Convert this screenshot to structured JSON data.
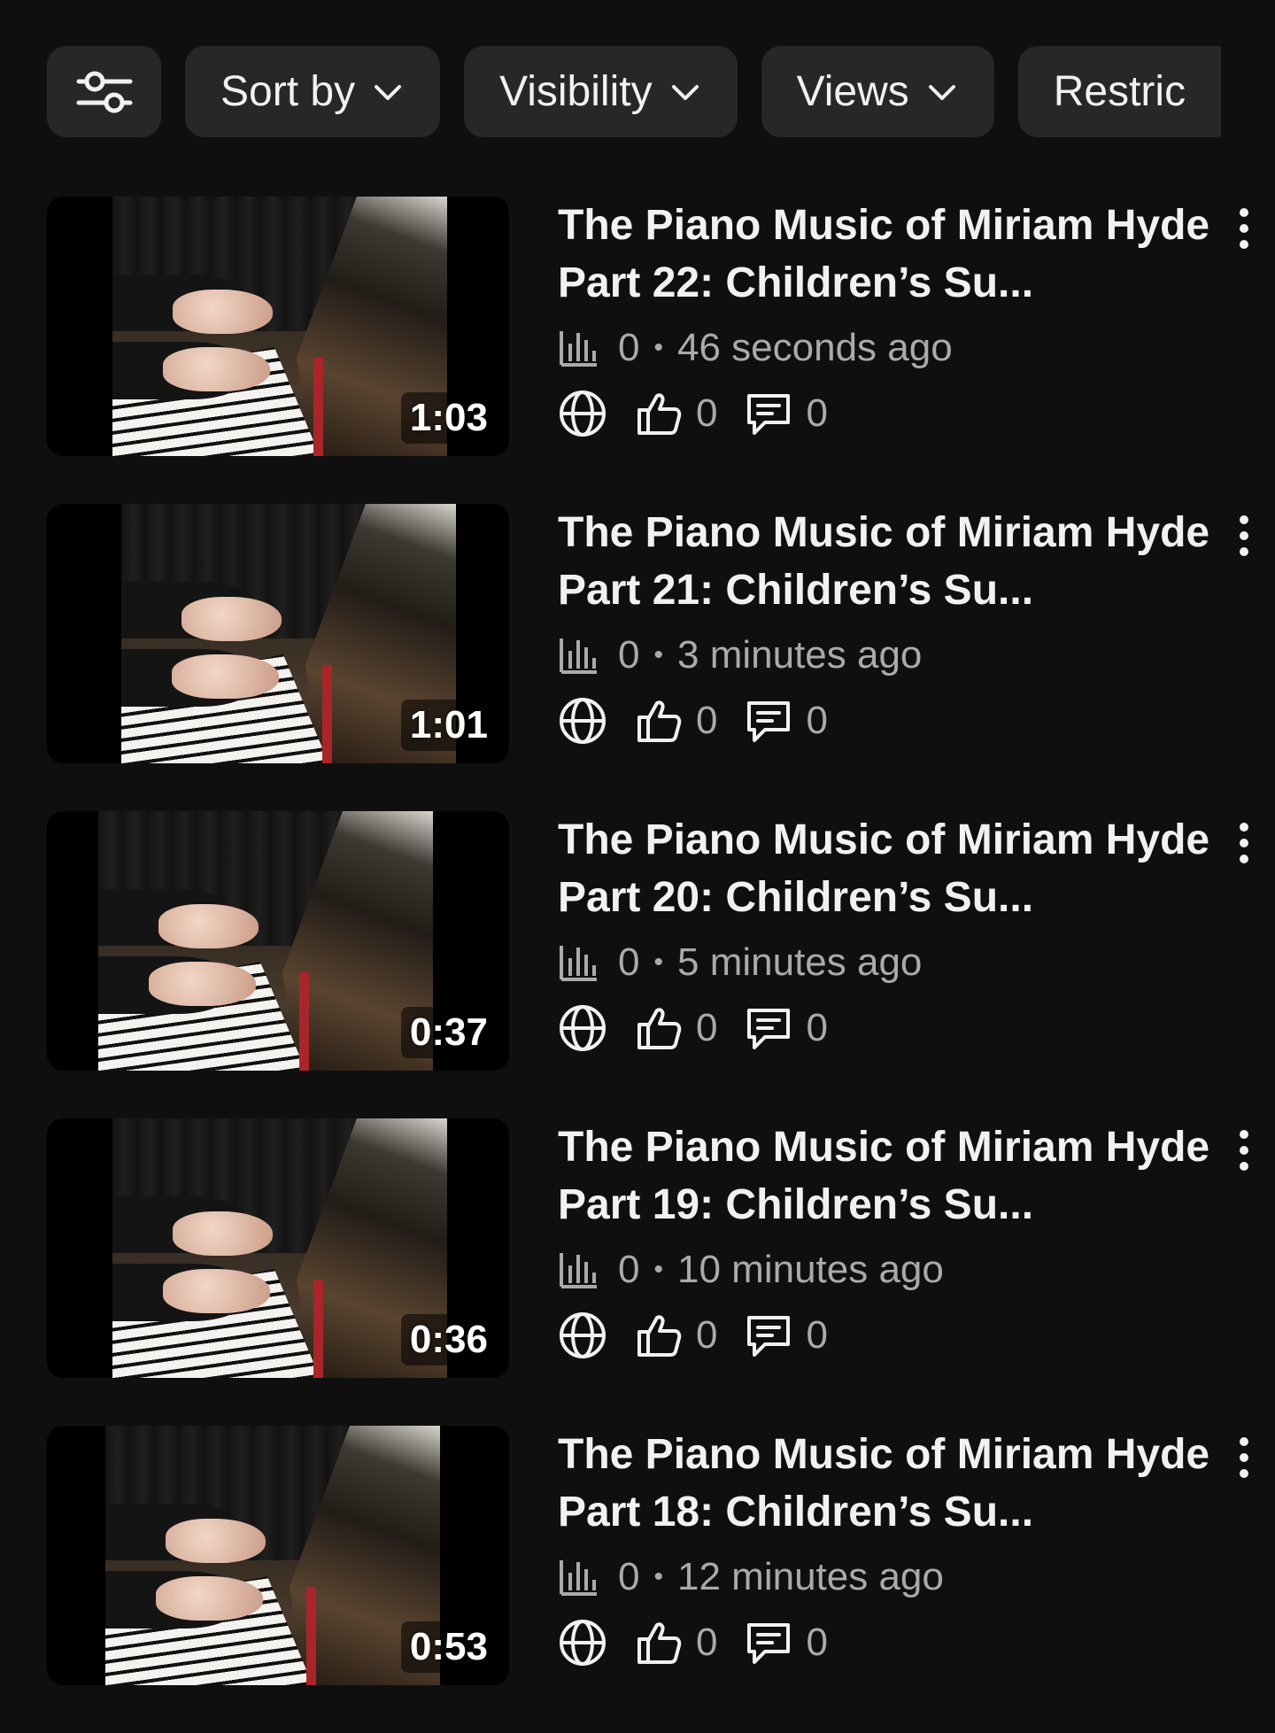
{
  "filters": {
    "icon": "sliders-icon",
    "chips": [
      {
        "label": "Sort by"
      },
      {
        "label": "Visibility"
      },
      {
        "label": "Views"
      },
      {
        "label": "Restric"
      }
    ]
  },
  "videos": [
    {
      "duration": "1:03",
      "title": "The Piano Music of Miriam Hyde Part 22: Children’s Su...",
      "views": "0",
      "time": "46 seconds ago",
      "likes": "0",
      "comments": "0"
    },
    {
      "duration": "1:01",
      "title": "The Piano Music of Miriam Hyde Part 21: Children’s Su...",
      "views": "0",
      "time": "3 minutes ago",
      "likes": "0",
      "comments": "0"
    },
    {
      "duration": "0:37",
      "title": "The Piano Music of Miriam Hyde Part 20: Children’s Su...",
      "views": "0",
      "time": "5 minutes ago",
      "likes": "0",
      "comments": "0"
    },
    {
      "duration": "0:36",
      "title": "The Piano Music of Miriam Hyde Part 19: Children’s Su...",
      "views": "0",
      "time": "10 minutes ago",
      "likes": "0",
      "comments": "0"
    },
    {
      "duration": "0:53",
      "title": "The Piano Music of Miriam Hyde Part 18: Children’s Su...",
      "views": "0",
      "time": "12 minutes ago",
      "likes": "0",
      "comments": "0"
    }
  ]
}
